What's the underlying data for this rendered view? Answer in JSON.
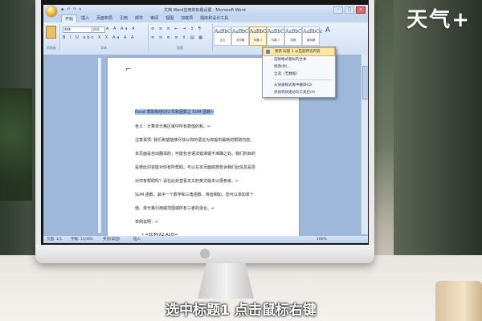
{
  "brand": {
    "logo_text": "天气+"
  },
  "caption": "选中标题1 点击鼠标右键",
  "word": {
    "window_title": "文档 Word应用的标题设置 - Microsoft Word",
    "window_controls": [
      "–",
      "□",
      "×"
    ],
    "tabs": [
      "开始",
      "插入",
      "页面布局",
      "引用",
      "邮件",
      "审阅",
      "视图",
      "加载项",
      "题库和设计工具"
    ],
    "active_tab": "开始",
    "ribbon": {
      "clipboard_label": "剪贴板",
      "font_label": "字体",
      "paragraph_label": "段落",
      "styles_label": "样式",
      "font_name": "宋体",
      "font_size": "四号",
      "font_row1": "A A  Aa  A",
      "font_row2": "B I U  abc X X  Aa  A  A",
      "para_row1": "≡ ≡ ≡  ⇤ ⇥  ↕  ¶",
      "para_row2": "≡ ≡ ≡ ≡  ⇕  ▤  ▦",
      "style_tiles": [
        {
          "sample": "AaBbCcDc",
          "name": "正文"
        },
        {
          "sample": "AaBbCcDc",
          "name": "无间隔"
        },
        {
          "sample": "AaBbC",
          "name": "标题 1"
        },
        {
          "sample": "AaBbC",
          "name": "标题 2"
        },
        {
          "sample": "AaBbCcI",
          "name": "标题"
        },
        {
          "sample": "AaBbCc",
          "name": "副标题"
        }
      ],
      "change_styles_label": "更改样式"
    },
    "context_menu": {
      "items": [
        "更新 标题 1 以匹配所选内容",
        "选择格式相似的文本",
        "修改(M)...",
        "全选: (无数据)",
        "从快速样式库中删除(Q)",
        "添加到快速访问工具栏(A)"
      ],
      "highlighted_index": 0
    },
    "document_lines": [
      "Excel 帮助和培训公式和函数之 SUM 函数↵",
      "含义：计算单元格区域中所有数值的和。↵",
      "注意事项:   我们希望能够尽快以你的语言为你提供最新的帮助内容。",
      "本页面是自动翻译的，可能包含语法错误或不准确之处。我们的目的",
      "是使此内容能对你有所帮助。可以在本页面底部告诉我们此信息是否",
      "对你有帮助吗？请在此处查看本文的英文版本以便参考。↵",
      "SUM 函数，其中一个数学和三角函数，将值相加。您可以添加单个",
      "值、单元格引用或范围或所有三者的混合。↵",
      "举例说明：↵",
      "•  =SUM(A2:A10)↵"
    ],
    "statusbar": {
      "page": "页面: 1/1",
      "words": "字数: 11/493",
      "lang": "英语(美国)",
      "mode": "插入",
      "zoom": "100%"
    }
  },
  "colors": {
    "ribbon_bg": "#d3e1f4",
    "selection": "#9cc3f0",
    "menu_highlight": "#fde7a6",
    "caption_text": "#ffffff"
  }
}
